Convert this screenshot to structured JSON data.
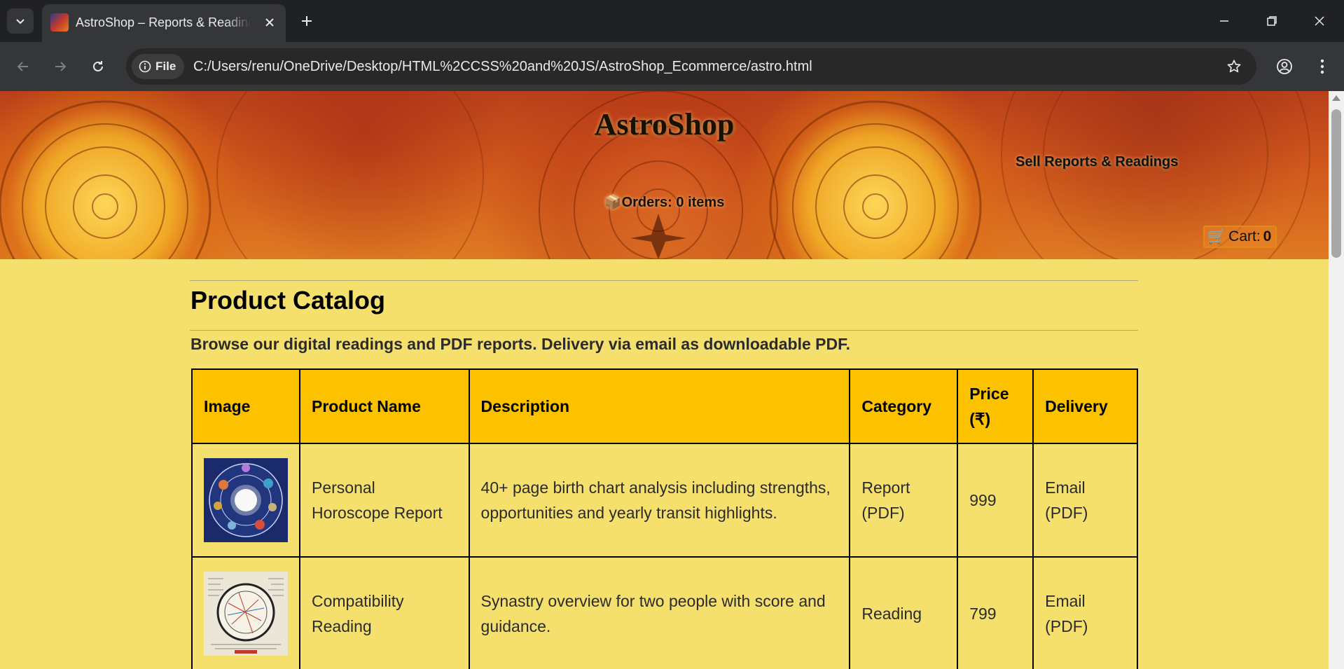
{
  "browser": {
    "tab_title": "AstroShop – Reports & Readings",
    "site_chip": "File",
    "url": "C:/Users/renu/OneDrive/Desktop/HTML%2CCSS%20and%20JS/AstroShop_Ecommerce/astro.html",
    "icons": [
      "tab-search-icon",
      "favicon",
      "close-icon",
      "plus-icon",
      "minimize-icon",
      "restore-icon",
      "close-window-icon",
      "back-arrow-icon",
      "forward-arrow-icon",
      "reload-icon",
      "info-icon",
      "star-icon",
      "profile-icon",
      "kebab-menu-icon"
    ]
  },
  "header": {
    "brand": "AstroShop",
    "tagline": "Sell Reports & Readings",
    "orders_label": "Orders:",
    "orders_count": "0",
    "orders_suffix": "items",
    "cart_label": "Cart:",
    "cart_count": "0"
  },
  "main": {
    "heading": "Product Catalog",
    "lead": "Browse our digital readings and PDF reports. Delivery via email as downloadable PDF.",
    "table": {
      "headers": [
        "Image",
        "Product Name",
        "Description",
        "Category",
        "Price (₹)",
        "Delivery"
      ],
      "rows": [
        {
          "image": "horoscope-wheel-image",
          "name": "Personal Horoscope Report",
          "description": "40+ page birth chart analysis including strengths, opportunities and yearly transit highlights.",
          "category": "Report (PDF)",
          "price": "999",
          "delivery": "Email (PDF)"
        },
        {
          "image": "compatibility-chart-image",
          "name": "Compatibility Reading",
          "description": "Synastry overview for two people with score and guidance.",
          "category": "Reading",
          "price": "799",
          "delivery": "Email (PDF)"
        }
      ]
    }
  },
  "colors": {
    "page_bg": "#f5e06e",
    "table_header_bg": "#fcc200",
    "chrome_dark": "#202124",
    "chrome_toolbar": "#35363a"
  }
}
